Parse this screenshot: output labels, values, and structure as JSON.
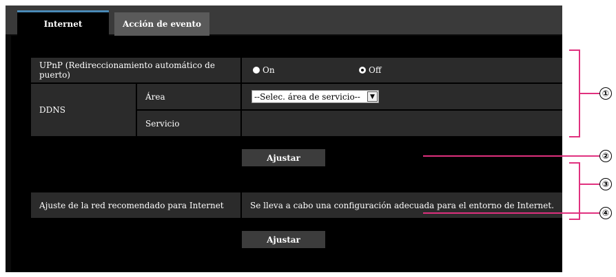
{
  "tabs": [
    {
      "label": "Internet",
      "active": true
    },
    {
      "label": "Acción de evento",
      "active": false
    }
  ],
  "upnp": {
    "label": "UPnP (Redireccionamiento automático de puerto)",
    "options": [
      {
        "label": "On",
        "selected": false
      },
      {
        "label": "Off",
        "selected": true
      }
    ]
  },
  "ddns": {
    "label": "DDNS",
    "area_label": "Área",
    "area_value": "--Selec. área de servicio--",
    "service_label": "Servicio",
    "service_value": ""
  },
  "buttons": {
    "ajustar_1": "Ajustar",
    "ajustar_2": "Ajustar"
  },
  "recommended": {
    "label": "Ajuste de la red recomendado para Internet",
    "description": "Se lleva a cabo una configuración adecuada para el entorno de Internet."
  },
  "callouts": [
    "①",
    "②",
    "③",
    "④"
  ],
  "colors": {
    "accent": "#e0307e",
    "tab_highlight": "#4a8ab8"
  }
}
